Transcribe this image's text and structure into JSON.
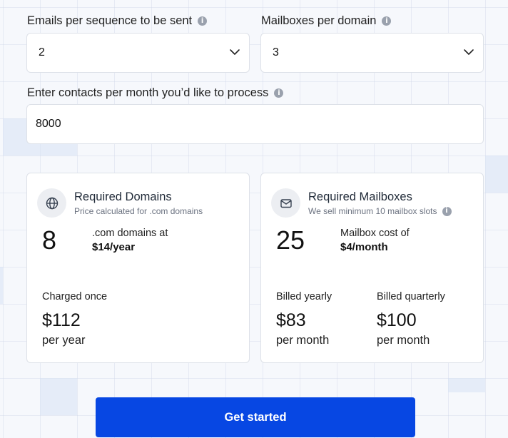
{
  "form": {
    "emails_per_sequence": {
      "label": "Emails per sequence to be sent",
      "value": "2"
    },
    "mailboxes_per_domain": {
      "label": "Mailboxes per domain",
      "value": "3"
    },
    "contacts_per_month": {
      "label": "Enter contacts per month you’d like to process",
      "value": "8000"
    }
  },
  "domains_card": {
    "title": "Required Domains",
    "subtitle": "Price calculated for .com domains",
    "count": "8",
    "rate_line1": ".com domains at",
    "rate_line2": "$14/year",
    "charge": {
      "label": "Charged once",
      "amount": "$112",
      "period": "per year"
    },
    "icon": "globe-icon"
  },
  "mailboxes_card": {
    "title": "Required Mailboxes",
    "subtitle": "We sell minimum 10 mailbox slots",
    "count": "25",
    "rate_line1": "Mailbox cost of",
    "rate_line2": "$4/month",
    "yearly": {
      "label": "Billed yearly",
      "amount": "$83",
      "period": "per month"
    },
    "quarterly": {
      "label": "Billed quarterly",
      "amount": "$100",
      "period": "per month"
    },
    "icon": "mail-icon"
  },
  "cta": {
    "label": "Get started"
  },
  "colors": {
    "primary": "#0747e3",
    "icon_bg": "#eceef2",
    "border": "#dde1e8"
  }
}
